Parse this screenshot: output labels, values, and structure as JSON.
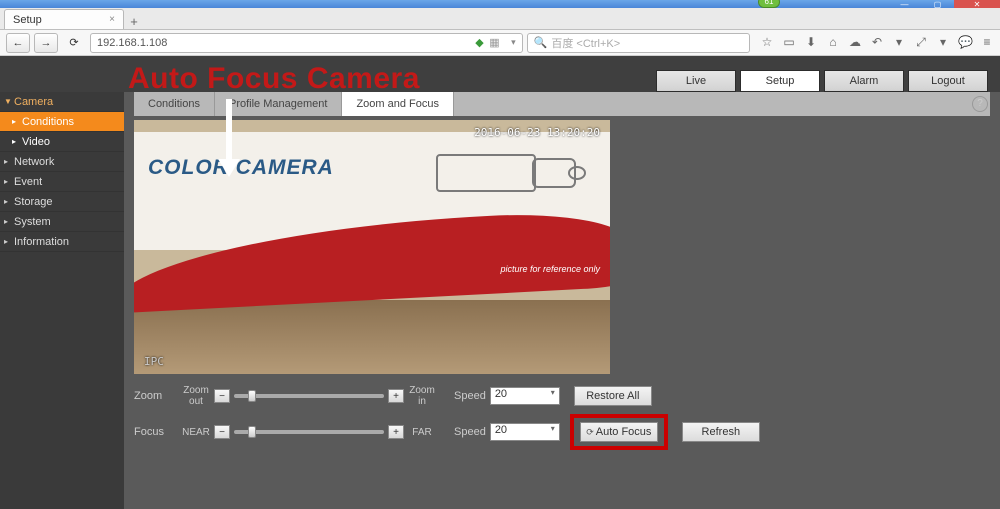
{
  "browser": {
    "tab_title": "Setup",
    "url": "192.168.1.108",
    "search_placeholder": "百度 <Ctrl+K>",
    "badge": "61"
  },
  "annotation": {
    "title": "Auto Focus Camera"
  },
  "header_tabs": {
    "live": "Live",
    "setup": "Setup",
    "alarm": "Alarm",
    "logout": "Logout"
  },
  "sidebar": {
    "camera": "Camera",
    "conditions": "Conditions",
    "video": "Video",
    "network": "Network",
    "event": "Event",
    "storage": "Storage",
    "system": "System",
    "information": "Information"
  },
  "inner_tabs": {
    "conditions": "Conditions",
    "profile": "Profile Management",
    "zoom_focus": "Zoom and Focus"
  },
  "preview": {
    "timestamp": "2016-06-23 13:20:20",
    "box_title": "COLOR CAMERA",
    "ref_text": "picture for reference only",
    "watermark": "IPC"
  },
  "controls": {
    "zoom_label": "Zoom",
    "zoom_out": "Zoom out",
    "zoom_in": "Zoom in",
    "focus_label": "Focus",
    "focus_near": "NEAR",
    "focus_far": "FAR",
    "speed_label": "Speed",
    "speed_value": "20",
    "restore_all": "Restore All",
    "auto_focus": "Auto Focus",
    "refresh": "Refresh"
  }
}
